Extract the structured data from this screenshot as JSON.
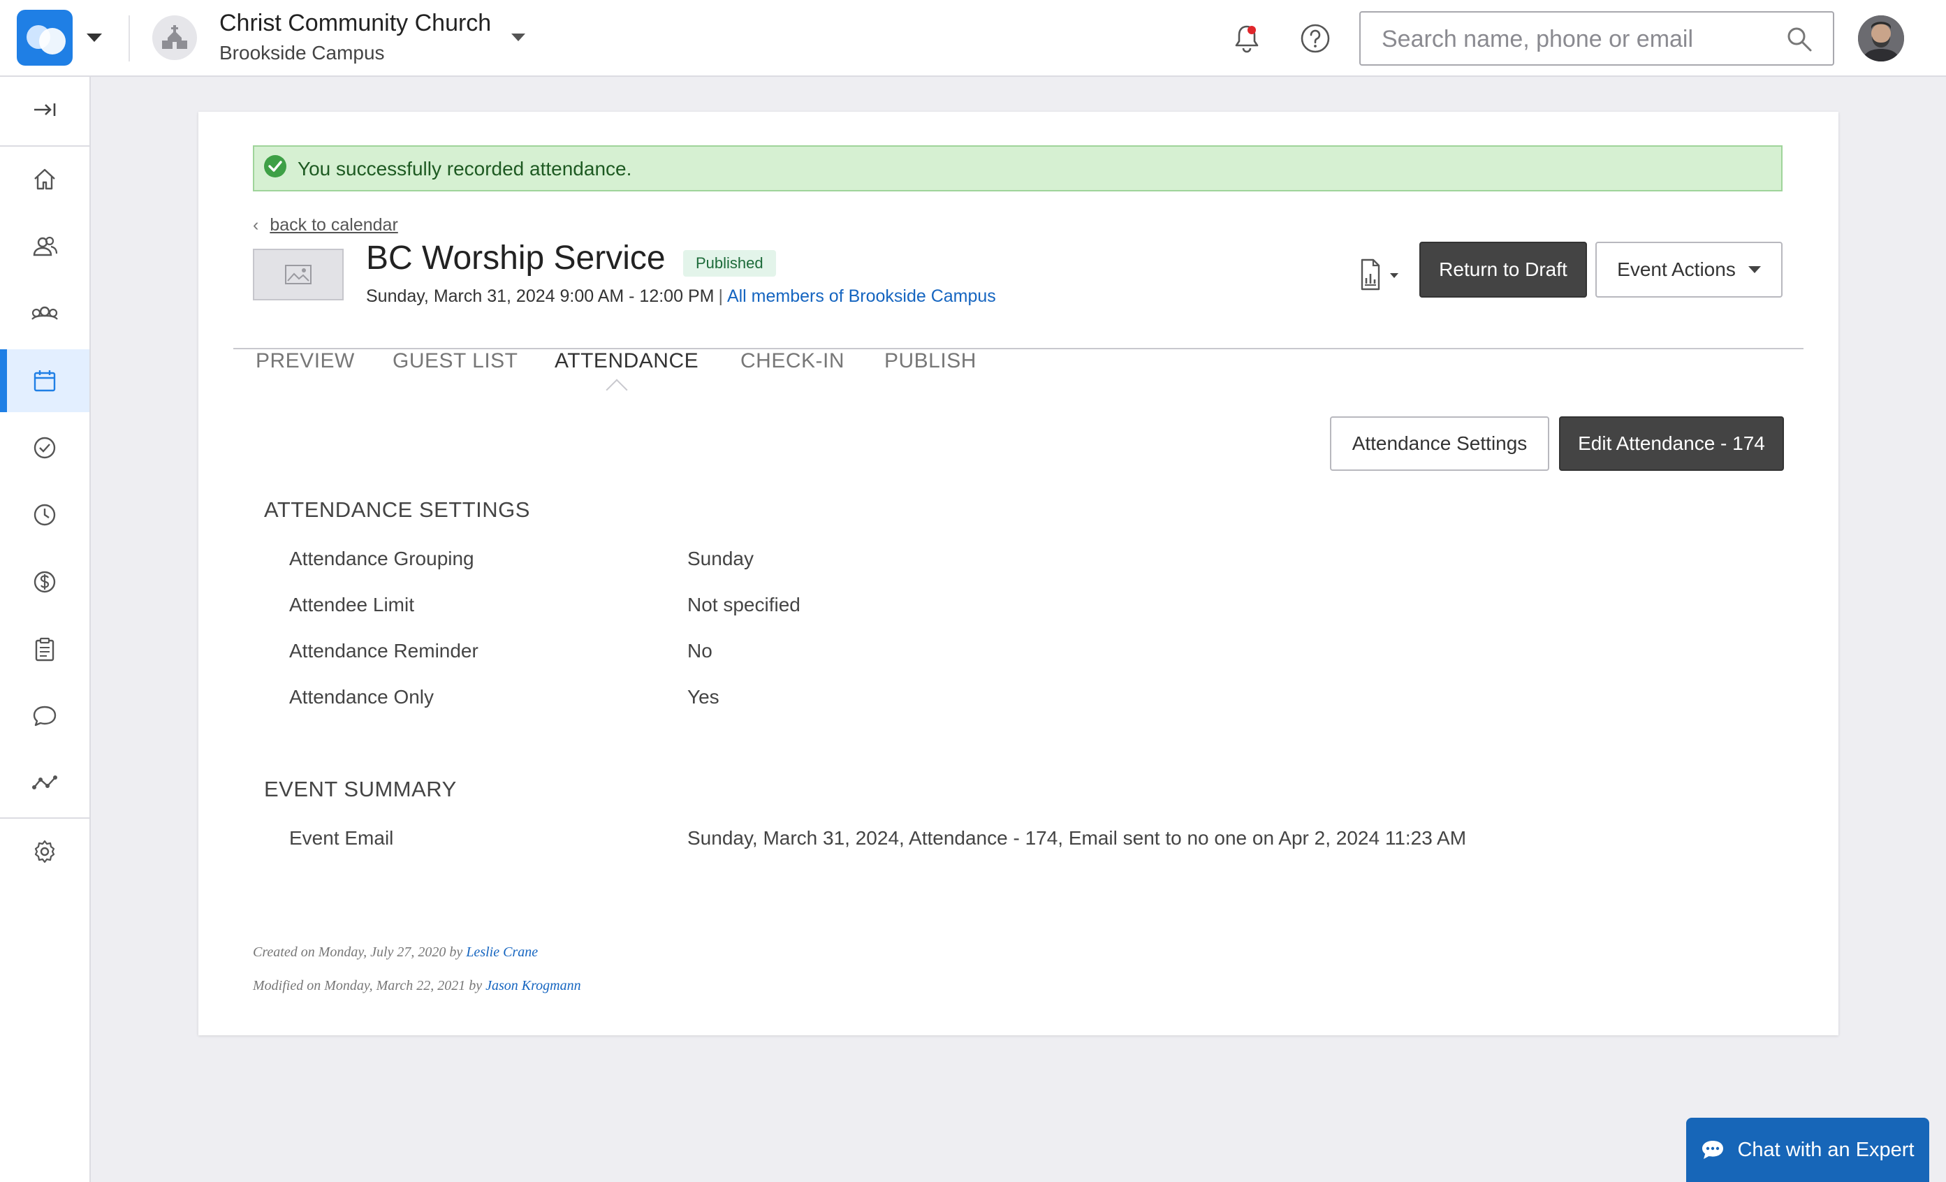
{
  "header": {
    "church_name": "Christ Community Church",
    "campus_name": "Brookside Campus",
    "search_placeholder": "Search name, phone or email",
    "notification_dot_color": "#e0262b",
    "brand_color": "#1f7fe5"
  },
  "sidebar": {
    "items": [
      {
        "icon": "collapse-icon"
      },
      {
        "icon": "home-icon"
      },
      {
        "icon": "people-icon"
      },
      {
        "icon": "groups-icon"
      },
      {
        "icon": "calendar-icon",
        "active": true
      },
      {
        "icon": "check-circle-icon"
      },
      {
        "icon": "clock-icon"
      },
      {
        "icon": "dollar-icon"
      },
      {
        "icon": "clipboard-icon"
      },
      {
        "icon": "chat-icon"
      },
      {
        "icon": "analytics-icon"
      },
      {
        "icon": "gear-icon"
      }
    ]
  },
  "alert": {
    "message": "You successfully recorded attendance."
  },
  "event": {
    "back_link": "back to calendar",
    "back_chevron": "‹",
    "title": "BC Worship Service",
    "status": "Published",
    "datetime": "Sunday, March 31, 2024 9:00 AM - 12:00 PM",
    "separator": "|",
    "audience_link": "All members of Brookside Campus"
  },
  "actions": {
    "return_to_draft": "Return to Draft",
    "event_actions": "Event Actions"
  },
  "tabs": [
    {
      "label": "PREVIEW"
    },
    {
      "label": "GUEST LIST"
    },
    {
      "label": "ATTENDANCE",
      "active": true
    },
    {
      "label": "CHECK-IN"
    },
    {
      "label": "PUBLISH"
    }
  ],
  "attendance_buttons": {
    "settings": "Attendance Settings",
    "edit": "Edit Attendance - 174"
  },
  "attendance_settings": {
    "title": "ATTENDANCE SETTINGS",
    "rows": [
      {
        "label": "Attendance Grouping",
        "value": "Sunday"
      },
      {
        "label": "Attendee Limit",
        "value": "Not specified"
      },
      {
        "label": "Attendance Reminder",
        "value": "No"
      },
      {
        "label": "Attendance Only",
        "value": "Yes"
      }
    ]
  },
  "event_summary": {
    "title": "EVENT SUMMARY",
    "rows": [
      {
        "label": "Event Email",
        "value": "Sunday, March 31, 2024, Attendance - 174, Email sent to no one on Apr 2, 2024 11:23 AM"
      }
    ]
  },
  "footer": {
    "created_prefix": "Created on Monday, July 27, 2020 by",
    "created_by": "Leslie Crane",
    "modified_prefix": "Modified on Monday, March 22, 2021 by",
    "modified_by": "Jason Krogmann"
  },
  "chat": {
    "label": "Chat with an Expert"
  }
}
